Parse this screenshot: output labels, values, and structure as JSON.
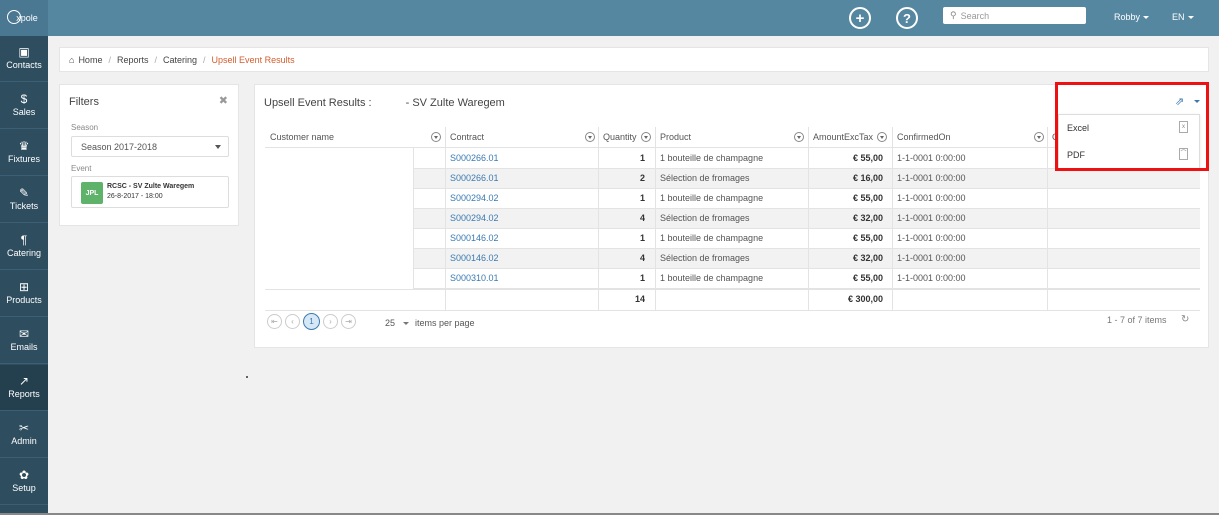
{
  "app": {
    "logo_text": "xpole"
  },
  "topbar": {
    "search_placeholder": "Search",
    "user": "Robby",
    "lang": "EN"
  },
  "sidebar": {
    "items": [
      {
        "label": "Contacts",
        "icon": "contacts-icon",
        "glyph": "▣"
      },
      {
        "label": "Sales",
        "icon": "sales-icon",
        "glyph": "$"
      },
      {
        "label": "Fixtures",
        "icon": "trophy-icon",
        "glyph": "♛"
      },
      {
        "label": "Tickets",
        "icon": "ticket-icon",
        "glyph": "✎"
      },
      {
        "label": "Catering",
        "icon": "cutlery-icon",
        "glyph": "¶"
      },
      {
        "label": "Products",
        "icon": "cart-icon",
        "glyph": "⊞"
      },
      {
        "label": "Emails",
        "icon": "envelope-icon",
        "glyph": "✉"
      },
      {
        "label": "Reports",
        "icon": "chart-icon",
        "glyph": "↗"
      },
      {
        "label": "Admin",
        "icon": "tools-icon",
        "glyph": "✂"
      },
      {
        "label": "Setup",
        "icon": "gears-icon",
        "glyph": "✿"
      }
    ]
  },
  "breadcrumb": {
    "home": "Home",
    "reports": "Reports",
    "catering": "Catering",
    "current": "Upsell Event Results"
  },
  "filters": {
    "title": "Filters",
    "season_label": "Season",
    "season_value": "Season 2017-2018",
    "event_label": "Event",
    "event_badge": "JPL",
    "event_name": "RCSC - SV Zulte Waregem",
    "event_date": "26-8-2017 - 18:00"
  },
  "results": {
    "title": "Upsell Event Results :",
    "event": "- SV Zulte Waregem",
    "columns": [
      "Customer name",
      "Contract",
      "Quantity",
      "Product",
      "AmountExcTax",
      "ConfirmedOn",
      "C"
    ],
    "rows": [
      {
        "contract": "S000266.01",
        "quantity": "1",
        "product": "1 bouteille de champagne",
        "amount": "€ 55,00",
        "confirmed": "1-1-0001 0:00:00"
      },
      {
        "contract": "S000266.01",
        "quantity": "2",
        "product": "Sélection de fromages",
        "amount": "€ 16,00",
        "confirmed": "1-1-0001 0:00:00"
      },
      {
        "contract": "S000294.02",
        "quantity": "1",
        "product": "1 bouteille de champagne",
        "amount": "€ 55,00",
        "confirmed": "1-1-0001 0:00:00"
      },
      {
        "contract": "S000294.02",
        "quantity": "4",
        "product": "Sélection de fromages",
        "amount": "€ 32,00",
        "confirmed": "1-1-0001 0:00:00"
      },
      {
        "contract": "S000146.02",
        "quantity": "1",
        "product": "1 bouteille de champagne",
        "amount": "€ 55,00",
        "confirmed": "1-1-0001 0:00:00"
      },
      {
        "contract": "S000146.02",
        "quantity": "4",
        "product": "Sélection de fromages",
        "amount": "€ 32,00",
        "confirmed": "1-1-0001 0:00:00"
      },
      {
        "contract": "S000310.01",
        "quantity": "1",
        "product": "1 bouteille de champagne",
        "amount": "€ 55,00",
        "confirmed": "1-1-0001 0:00:00"
      }
    ],
    "totals": {
      "quantity": "14",
      "amount": "€ 300,00"
    },
    "pager": {
      "current_page": "1",
      "page_size": "25",
      "items_per_page": "items per page",
      "info": "1 - 7 of 7 items"
    }
  },
  "export": {
    "options": [
      "Excel",
      "PDF"
    ]
  },
  "colors": {
    "topbar": "#5687a1",
    "sidebar": "#2e4e60",
    "accent_link": "#3a7ab3",
    "breadcrumb_current": "#d35e2f",
    "highlight": "#ee1111"
  }
}
